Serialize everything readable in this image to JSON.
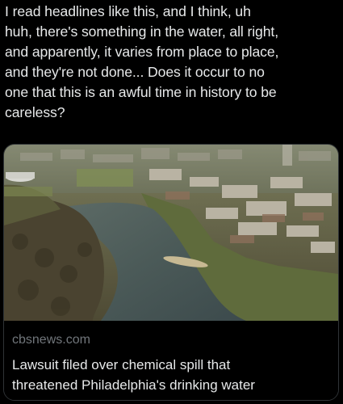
{
  "post": {
    "text_lines": [
      "I read headlines like this, and I think, uh",
      "huh, there's something in the water, all right,",
      "and apparently, it varies from place to place,",
      "and they're not done... Does it occur to no",
      "one that this is an awful time in history to be",
      "careless?"
    ]
  },
  "card": {
    "domain": "cbsnews.com",
    "title_lines": [
      "Lawsuit filed over chemical spill that",
      "threatened Philadelphia's drinking water"
    ],
    "image_icon": "aerial-photo-river-town"
  },
  "colors": {
    "background": "#000000",
    "text": "#e7e9ea",
    "muted": "#71767b",
    "border": "#2f3336"
  }
}
